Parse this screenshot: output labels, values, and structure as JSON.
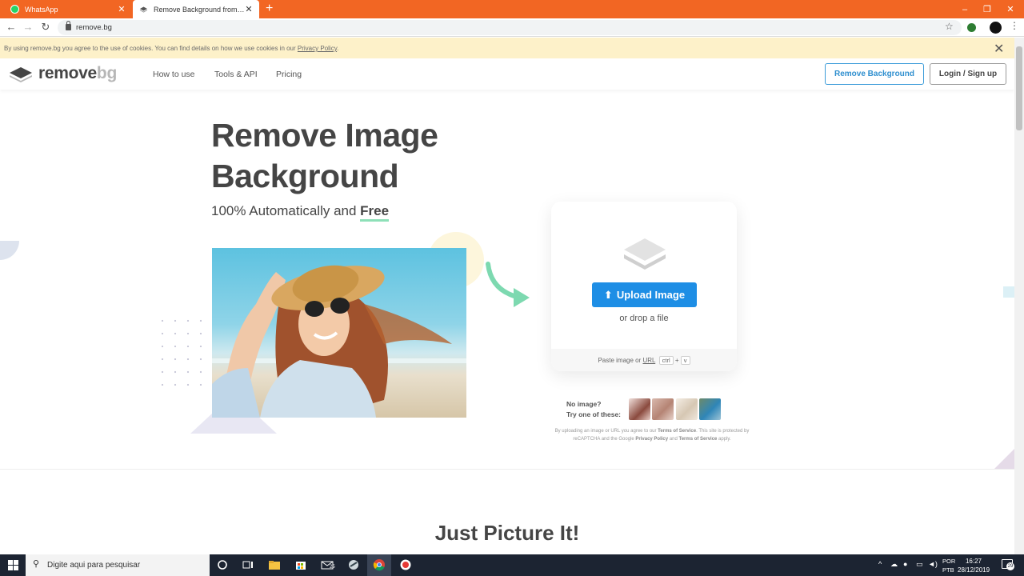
{
  "browser": {
    "tabs": [
      {
        "title": "WhatsApp",
        "icon": "whatsapp-icon"
      },
      {
        "title": "Remove Background from Image",
        "icon": "removebg-icon"
      }
    ],
    "new_tab_symbol": "+",
    "window_controls": {
      "minimize": "–",
      "maximize": "❐",
      "close": "✕"
    },
    "url": "remove.bg"
  },
  "cookie_banner": {
    "text": "By using remove.bg you agree to the use of cookies. You can find details on how we use cookies in our ",
    "link": "Privacy Policy",
    "end": "."
  },
  "site_nav": {
    "logo_remove": "remove",
    "logo_bg": "bg",
    "links": [
      "How to use",
      "Tools & API",
      "Pricing"
    ],
    "primary_button": "Remove Background",
    "login_button": "Login / Sign up"
  },
  "hero": {
    "title_line1": "Remove Image",
    "title_line2": "Background",
    "subtitle_prefix": "100% Automatically and ",
    "subtitle_emphasis": "Free"
  },
  "upload": {
    "button": "Upload Image",
    "drop_text": "or drop a file",
    "paste_prefix": "Paste image or ",
    "paste_url": "URL",
    "key_ctrl": "ctrl",
    "key_plus": "+",
    "key_v": "v"
  },
  "samples": {
    "line1": "No image?",
    "line2": "Try one of these:"
  },
  "legal": {
    "part1": "By uploading an image or URL you agree to our ",
    "tos1": "Terms of Service",
    "part2": ". This site is protected by reCAPTCHA and the Google ",
    "privacy": "Privacy Policy",
    "part3": " and ",
    "tos2": "Terms of Service",
    "part4": " apply."
  },
  "section": {
    "title": "Just Picture It!"
  },
  "taskbar": {
    "search_placeholder": "Digite aqui para pesquisar",
    "lang_line1": "POR",
    "lang_line2": "PTB",
    "time": "16:27",
    "date": "28/12/2019",
    "notification_count": "29",
    "mail_badge": "25"
  },
  "colors": {
    "chrome_orange": "#f26623",
    "accent_blue": "#1e8ee5",
    "underline_green": "#8ee0b8",
    "cookie_bg": "#fdf1c9",
    "taskbar": "#1c2432"
  }
}
